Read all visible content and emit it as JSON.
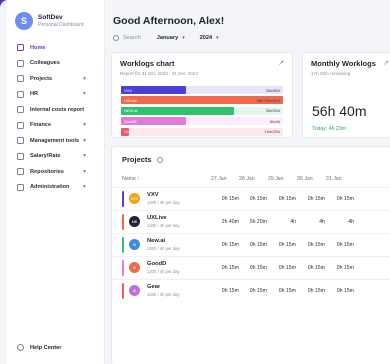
{
  "brand": {
    "logo_letter": "S",
    "name": "SoftDev",
    "subtitle": "Personal Dashboard"
  },
  "nav": [
    {
      "label": "Home",
      "name": "home",
      "active": true,
      "chevron": false
    },
    {
      "label": "Colleagues",
      "name": "colleagues",
      "active": false,
      "chevron": false
    },
    {
      "label": "Projects",
      "name": "projects",
      "active": false,
      "chevron": true
    },
    {
      "label": "HR",
      "name": "hr",
      "active": false,
      "chevron": true
    },
    {
      "label": "Internal costs report",
      "name": "internal-costs-report",
      "active": false,
      "chevron": false
    },
    {
      "label": "Finance",
      "name": "finance",
      "active": false,
      "chevron": true
    },
    {
      "label": "Management tools",
      "name": "management-tools",
      "active": false,
      "chevron": true
    },
    {
      "label": "Salary/Rate",
      "name": "salary-rate",
      "active": false,
      "chevron": true
    },
    {
      "label": "Repositories",
      "name": "repositories",
      "active": false,
      "chevron": true
    },
    {
      "label": "Administration",
      "name": "administration",
      "active": false,
      "chevron": true
    }
  ],
  "help": "Help Center",
  "greeting": "Good Afternoon, Alex!",
  "filters": {
    "search_label": "Search",
    "month": "January",
    "year": "2024"
  },
  "worklogs": {
    "title": "Worklogs chart",
    "subtitle": "Report for 31 Dec 2023 - 31 Dec 2023",
    "rows": [
      {
        "label": "VXV",
        "value": "30h/80h",
        "fraction": 0.4,
        "color": "#4b3fd8"
      },
      {
        "label": "UXLive",
        "value": "58h 30m/80h",
        "fraction": 1.0,
        "color": "#ef6a4c"
      },
      {
        "label": "NEW.ai",
        "value": "35h/50h",
        "fraction": 0.7,
        "color": "#2fc36f"
      },
      {
        "label": "GoodD",
        "value": "5h/4h",
        "fraction": 0.4,
        "color": "#e27bd8"
      },
      {
        "label": "Gear",
        "value": "15m/20h",
        "fraction": 0.05,
        "color": "#f25767"
      }
    ]
  },
  "monthly": {
    "title": "Monthly Worklogs",
    "subtitle": "17h 20m remaining",
    "total": "56h 40m",
    "today": "Today: 4h 20m"
  },
  "projects": {
    "title": "Projects",
    "name_header": "Name ↑",
    "dates": [
      "27 Jan",
      "28 Jan",
      "29 Jan",
      "30 Jan",
      "31 Jan"
    ],
    "rows": [
      {
        "name": "VXV",
        "meta": "120h / 4h per day",
        "avatar_text": "VXV",
        "avatar_color": "#f2a216",
        "bar_color": "#4b3fd8",
        "cells": [
          "0h 15m",
          "0h 15m",
          "0h 15m",
          "0h 15m",
          "0h 15m"
        ]
      },
      {
        "name": "UXLive",
        "meta": "120h / 4h per day",
        "avatar_text": "UX",
        "avatar_color": "#1f2230",
        "bar_color": "#ef6a4c",
        "cells": [
          "2h 40m",
          "5h 20m",
          "4h",
          "4h",
          "4h"
        ]
      },
      {
        "name": "New.ai",
        "meta": "120h / 4h per day",
        "avatar_text": "N",
        "avatar_color": "#3a8dde",
        "bar_color": "#2fc36f",
        "cells": [
          "0h 15m",
          "0h 15m",
          "0h 15m",
          "0h 15m",
          "0h 15m"
        ]
      },
      {
        "name": "GoodD",
        "meta": "120h / 4h per day",
        "avatar_text": "G",
        "avatar_color": "#ef6a4c",
        "bar_color": "#e27bd8",
        "cells": [
          "0h 15m",
          "0h 15m",
          "0h 15m",
          "0h 15m",
          "0h 15m"
        ]
      },
      {
        "name": "Gear",
        "meta": "120h / 4h per day",
        "avatar_text": "G",
        "avatar_color": "#c06fe0",
        "bar_color": "#f25767",
        "cells": [
          "0h 15m",
          "0h 15m",
          "0h 15m",
          "0h 15m",
          "0h 15m"
        ]
      }
    ]
  }
}
